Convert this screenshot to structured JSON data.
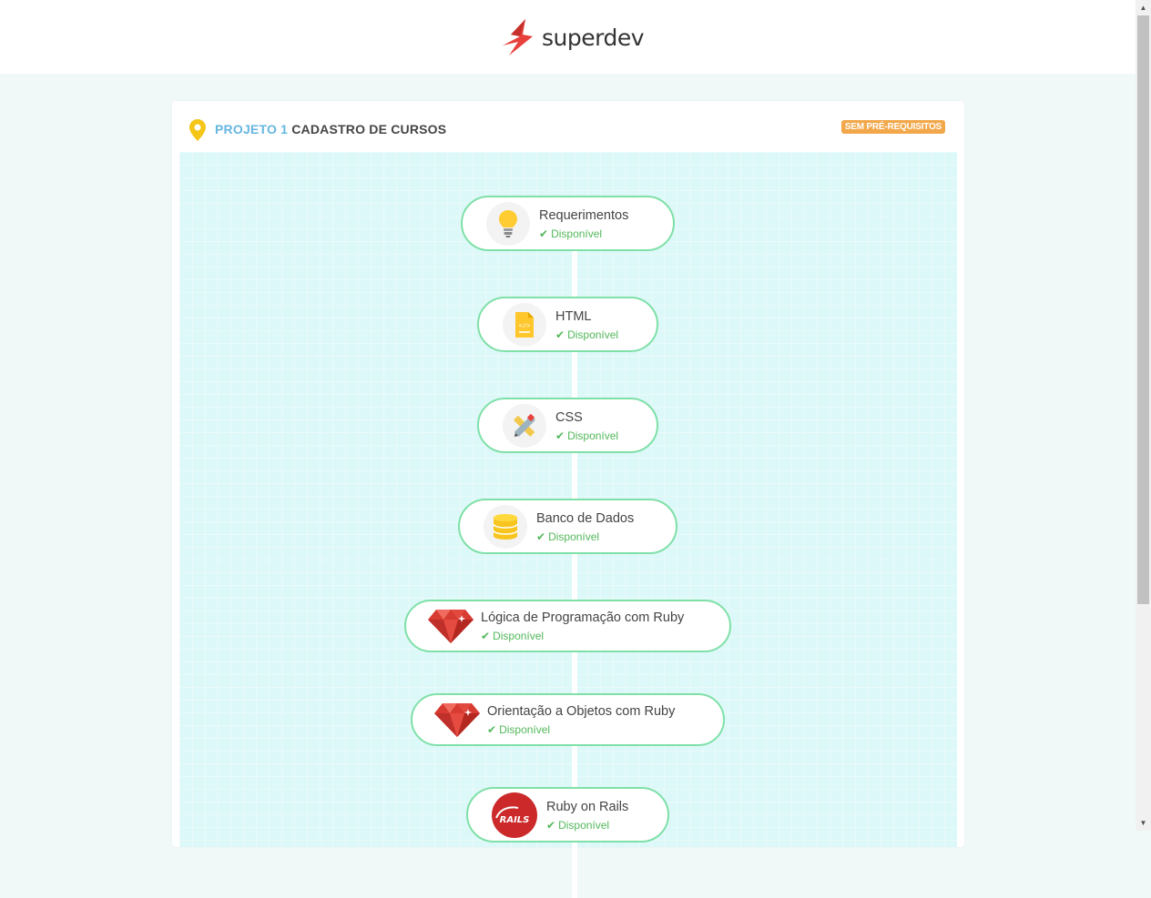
{
  "header": {
    "logo_prefix": "super",
    "logo_suffix": "dev"
  },
  "project": {
    "label": "PROJETO 1",
    "name": "CADASTRO DE CURSOS",
    "badge": "SEM PRÉ-REQUISITOS"
  },
  "courses": [
    {
      "title": "Requerimentos",
      "status": "Disponível",
      "icon": "lightbulb-icon"
    },
    {
      "title": "HTML",
      "status": "Disponível",
      "icon": "html-file-icon"
    },
    {
      "title": "CSS",
      "status": "Disponível",
      "icon": "pencil-ruler-icon"
    },
    {
      "title": "Banco de Dados",
      "status": "Disponível",
      "icon": "database-icon"
    },
    {
      "title": "Lógica de Programação com Ruby",
      "status": "Disponível",
      "icon": "ruby-gem-icon"
    },
    {
      "title": "Orientação a Objetos com Ruby",
      "status": "Disponível",
      "icon": "ruby-gem-icon"
    },
    {
      "title": "Ruby on Rails",
      "status": "Disponível",
      "icon": "rails-icon"
    }
  ],
  "rails_logo_text": "RAILS",
  "colors": {
    "accent_blue": "#66b6e0",
    "badge_orange": "#f2a84a",
    "node_border": "#7fe0a8",
    "status_green": "#52b85a",
    "map_bg": "#ddf8f8",
    "logo_red": "#e8413c"
  }
}
